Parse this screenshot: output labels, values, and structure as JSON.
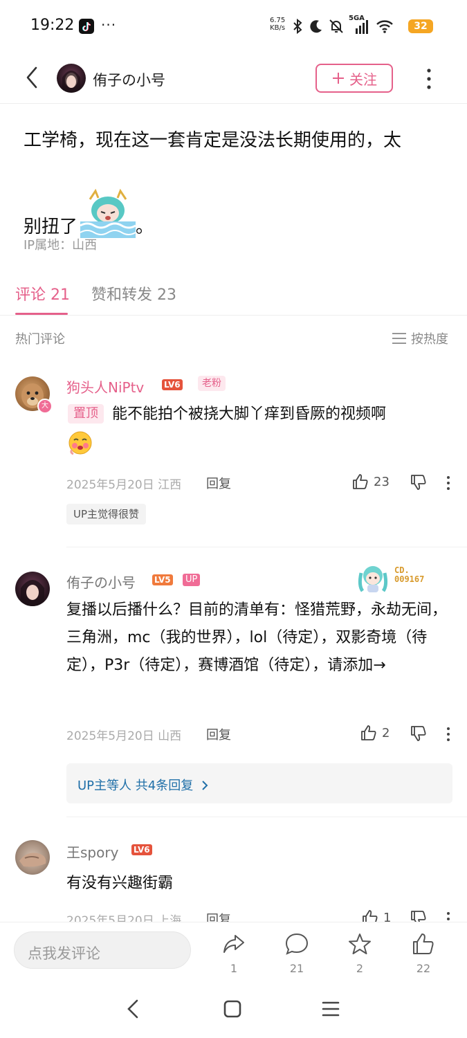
{
  "status_bar": {
    "time": "19:22",
    "net_speed_value": "6.75",
    "net_speed_unit": "KB/s",
    "network_label": "5GA",
    "battery": "32"
  },
  "header": {
    "username": "侑子の小号",
    "follow_label": "关注"
  },
  "post": {
    "text_line1": "工学椅，现在这一套肯定是没法长期使用的，太",
    "text_line2": "别扭了",
    "text_end": "。",
    "ip_location": "IP属地：山西"
  },
  "tabs": [
    {
      "label": "评论 21",
      "active": true
    },
    {
      "label": "赞和转发 23",
      "active": false
    }
  ],
  "comments_header": {
    "hot_label": "热门评论",
    "sort_label": "按热度"
  },
  "comments": [
    {
      "username": "狗头人NiPtv",
      "level": "LV6",
      "fan_badge": "老粉",
      "vip_badge": "大",
      "pinned_label": "置顶",
      "text": "能不能拍个被挠大脚丫痒到昏厥的视频啊",
      "meta": "2025年5月20日 江西",
      "reply_label": "回复",
      "likes": "23",
      "up_tag": "UP主觉得很赞"
    },
    {
      "username": "侑子の小号",
      "level": "LV5",
      "up_badge": "UP",
      "cd_label": "CD.",
      "cd_number": "009167",
      "text": "复播以后播什么？目前的清单有：怪猎荒野，永劫无间，三角洲，mc（我的世界），lol（待定），双影奇境（待定），P3r（待定），赛博酒馆（待定），请添加→",
      "meta": "2025年5月20日 山西",
      "reply_label": "回复",
      "likes": "2",
      "replies_summary": "UP主等人 共4条回复"
    },
    {
      "username": "王spory",
      "level": "LV6",
      "text": "有没有兴趣街霸",
      "meta": "2025年5月20日 上海",
      "reply_label": "回复",
      "likes": "1"
    }
  ],
  "bottom_bar": {
    "comment_placeholder": "点我发评论",
    "share_count": "1",
    "comment_count": "21",
    "favorite_count": "2",
    "like_count": "22"
  },
  "colors": {
    "accent_pink": "#e5608a",
    "link_blue": "#1f6fa8",
    "battery_orange": "#f5a623"
  }
}
